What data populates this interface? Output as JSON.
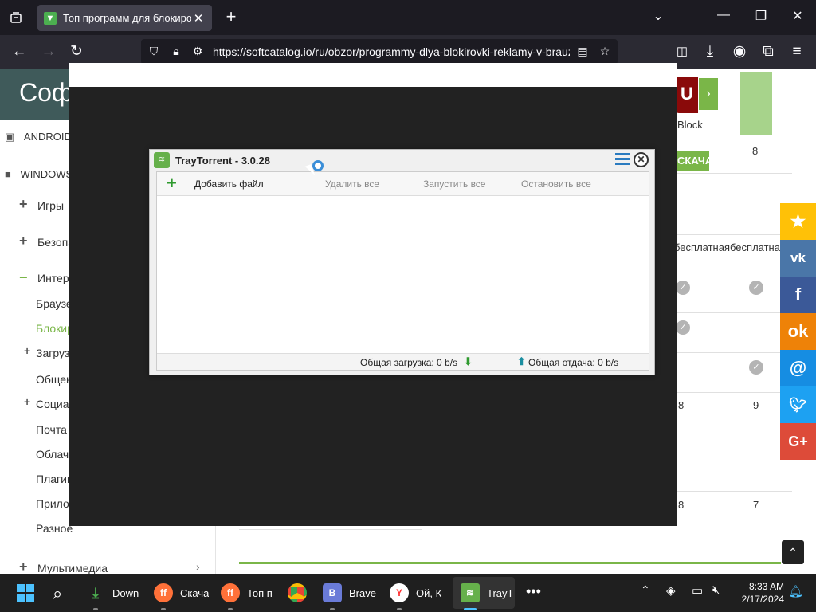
{
  "browser": {
    "tab_title": "Топ программ для блокировки",
    "url": "https://softcatalog.io/ru/obzor/programmy-dlya-blokirovki-reklamy-v-brauzere"
  },
  "page": {
    "brand": "Софт",
    "sidebar": {
      "android": "ANDROID",
      "windows": "WINDOWS",
      "items": [
        "Игры",
        "Безопасность",
        "Интернет",
        "Браузеры",
        "Блокировка рекламы",
        "Загрузка файлов",
        "Общение",
        "Социальные сети",
        "Почта",
        "Облачные хранилища",
        "Плагины",
        "Приложения",
        "Разное",
        "Мультимедиа"
      ]
    },
    "table": {
      "col_a_header": "бесплатная",
      "col_b_header": "бесплатная",
      "ublock_label": "Block",
      "download_label": "СКАЧАТЬ",
      "score_top": "8",
      "rating_row1": [
        "8",
        "9"
      ],
      "rating_row2": [
        "8",
        "7"
      ]
    },
    "share_colors": [
      "#ffc107",
      "#4a76a8",
      "#3b5998",
      "#ee8208",
      "#168de2",
      "#1da1f2",
      "#dd4b39"
    ]
  },
  "app": {
    "title": "TrayTorrent - 3.0.28",
    "toolbar": {
      "add": "Добавить файл",
      "remove_all": "Удалить все",
      "start_all": "Запустить все",
      "stop_all": "Остановить все"
    },
    "status": {
      "download": "Общая загрузка: 0 b/s",
      "upload": "Общая отдача: 0 b/s"
    }
  },
  "taskbar": {
    "items": [
      {
        "label": "Down",
        "icon": "download-icon"
      },
      {
        "label": "Скача",
        "icon": "firefox-icon"
      },
      {
        "label": "Топ п",
        "icon": "firefox-icon"
      },
      {
        "label": "",
        "icon": "chrome-icon"
      },
      {
        "label": "Brave",
        "icon": "brave-icon"
      },
      {
        "label": "Ой, К",
        "icon": "yandex-icon"
      },
      {
        "label": "TrayT",
        "icon": "traytorrent-icon"
      }
    ],
    "time": "8:33 AM",
    "date": "2/17/2024"
  }
}
